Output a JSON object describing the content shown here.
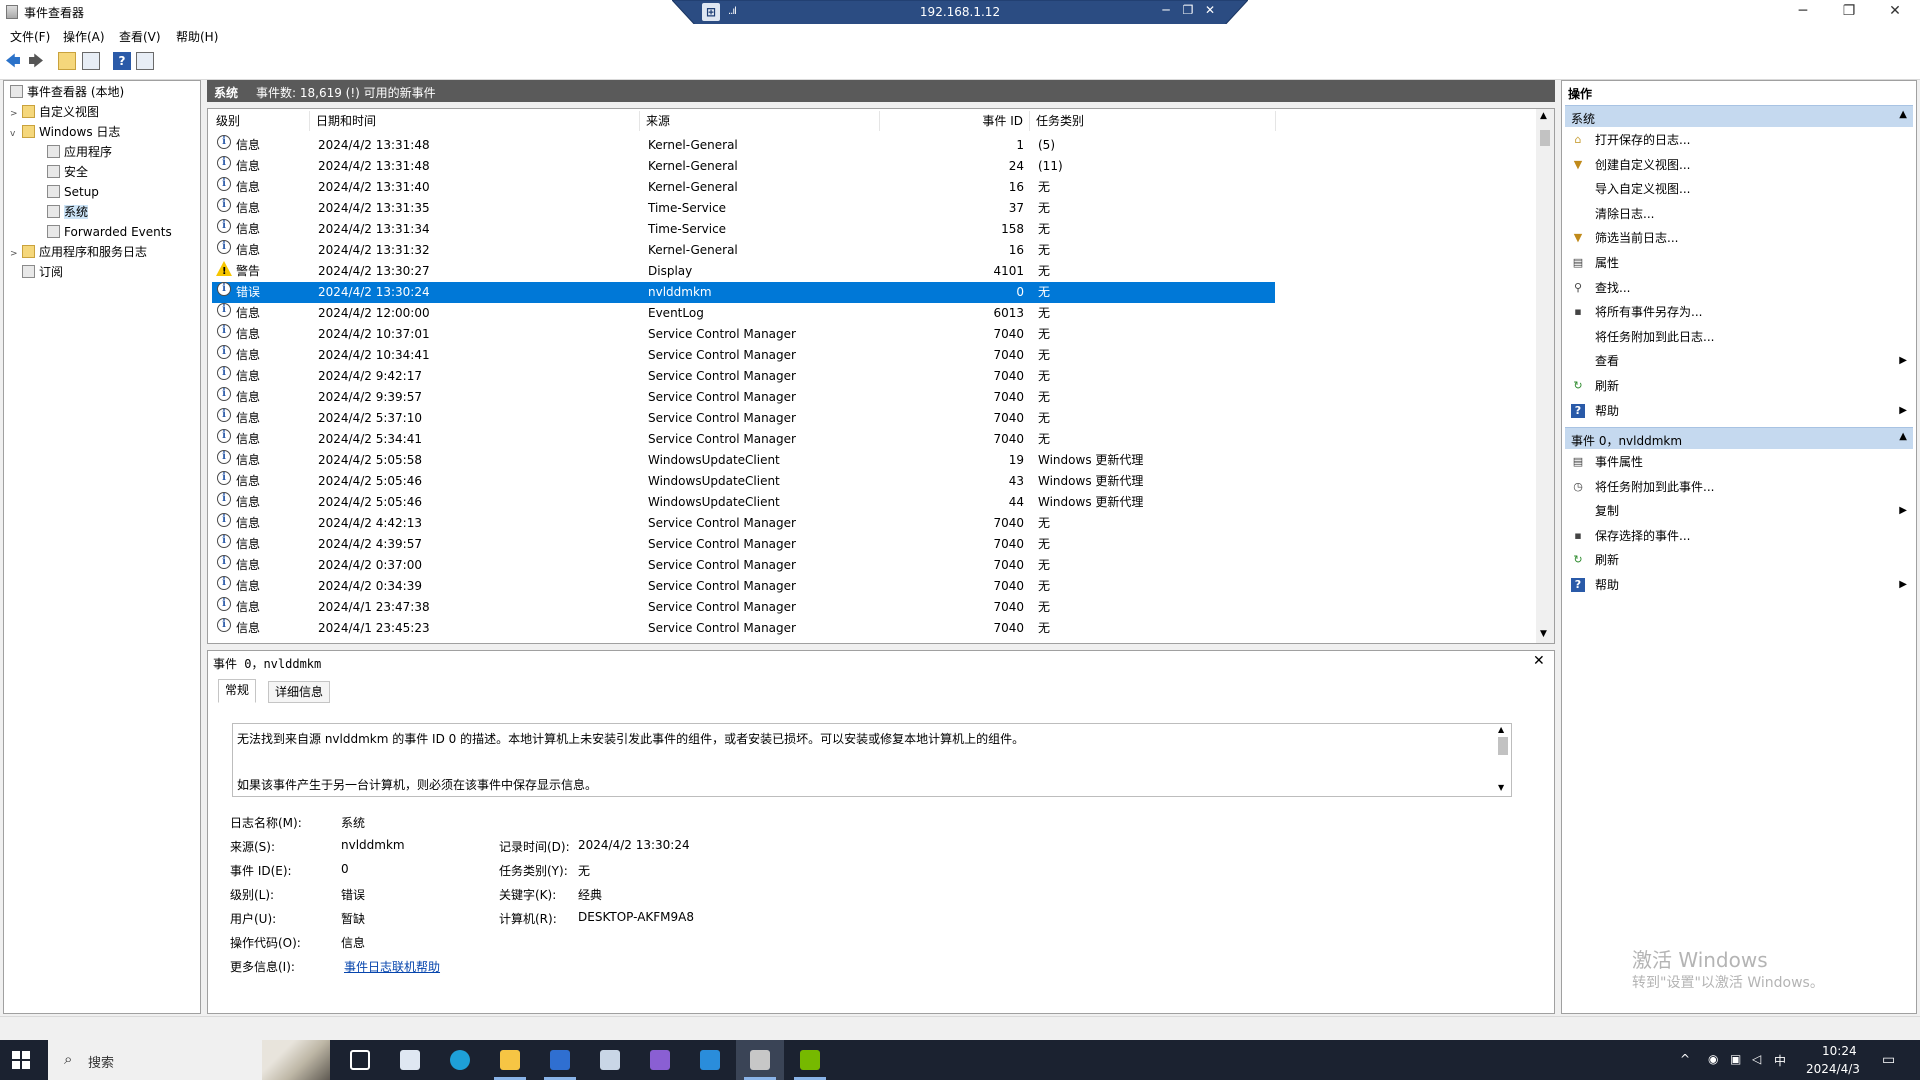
{
  "window": {
    "title": "事件查看器",
    "minimize": "─",
    "maximize": "❐",
    "close": "✕"
  },
  "rdp": {
    "ip": "192.168.1.12",
    "signal": "..ıl",
    "pin": "⊞",
    "min": "─",
    "restore": "❐",
    "close": "✕"
  },
  "menu": [
    "文件(F)",
    "操作(A)",
    "查看(V)",
    "帮助(H)"
  ],
  "toolbar": [
    "back-icon",
    "forward-icon",
    "up-folder-icon",
    "show-hide-tree-icon",
    "help-icon",
    "show-hide-action-icon"
  ],
  "tree": {
    "root": "事件查看器 (本地)",
    "custom_views": "自定义视图",
    "windows_logs": "Windows 日志",
    "application": "应用程序",
    "security": "安全",
    "setup": "Setup",
    "system": "系统",
    "forwarded": "Forwarded Events",
    "app_service_logs": "应用程序和服务日志",
    "subscriptions": "订阅"
  },
  "center_header": {
    "title": "系统",
    "summary": "事件数: 18,619 (!) 可用的新事件"
  },
  "columns": {
    "level": "级别",
    "datetime": "日期和时间",
    "source": "来源",
    "event_id": "事件 ID",
    "task": "任务类别"
  },
  "events": [
    {
      "type": "info",
      "level": "信息",
      "datetime": "2024/4/2 13:31:48",
      "source": "Kernel-General",
      "id": "1",
      "task": "(5)"
    },
    {
      "type": "info",
      "level": "信息",
      "datetime": "2024/4/2 13:31:48",
      "source": "Kernel-General",
      "id": "24",
      "task": "(11)"
    },
    {
      "type": "info",
      "level": "信息",
      "datetime": "2024/4/2 13:31:40",
      "source": "Kernel-General",
      "id": "16",
      "task": "无"
    },
    {
      "type": "info",
      "level": "信息",
      "datetime": "2024/4/2 13:31:35",
      "source": "Time-Service",
      "id": "37",
      "task": "无"
    },
    {
      "type": "info",
      "level": "信息",
      "datetime": "2024/4/2 13:31:34",
      "source": "Time-Service",
      "id": "158",
      "task": "无"
    },
    {
      "type": "info",
      "level": "信息",
      "datetime": "2024/4/2 13:31:32",
      "source": "Kernel-General",
      "id": "16",
      "task": "无"
    },
    {
      "type": "warn",
      "level": "警告",
      "datetime": "2024/4/2 13:30:27",
      "source": "Display",
      "id": "4101",
      "task": "无"
    },
    {
      "type": "info",
      "level": "错误",
      "datetime": "2024/4/2 13:30:24",
      "source": "nvlddmkm",
      "id": "0",
      "task": "无",
      "selected": true
    },
    {
      "type": "info",
      "level": "信息",
      "datetime": "2024/4/2 12:00:00",
      "source": "EventLog",
      "id": "6013",
      "task": "无"
    },
    {
      "type": "info",
      "level": "信息",
      "datetime": "2024/4/2 10:37:01",
      "source": "Service Control Manager",
      "id": "7040",
      "task": "无"
    },
    {
      "type": "info",
      "level": "信息",
      "datetime": "2024/4/2 10:34:41",
      "source": "Service Control Manager",
      "id": "7040",
      "task": "无"
    },
    {
      "type": "info",
      "level": "信息",
      "datetime": "2024/4/2 9:42:17",
      "source": "Service Control Manager",
      "id": "7040",
      "task": "无"
    },
    {
      "type": "info",
      "level": "信息",
      "datetime": "2024/4/2 9:39:57",
      "source": "Service Control Manager",
      "id": "7040",
      "task": "无"
    },
    {
      "type": "info",
      "level": "信息",
      "datetime": "2024/4/2 5:37:10",
      "source": "Service Control Manager",
      "id": "7040",
      "task": "无"
    },
    {
      "type": "info",
      "level": "信息",
      "datetime": "2024/4/2 5:34:41",
      "source": "Service Control Manager",
      "id": "7040",
      "task": "无"
    },
    {
      "type": "info",
      "level": "信息",
      "datetime": "2024/4/2 5:05:58",
      "source": "WindowsUpdateClient",
      "id": "19",
      "task": "Windows 更新代理"
    },
    {
      "type": "info",
      "level": "信息",
      "datetime": "2024/4/2 5:05:46",
      "source": "WindowsUpdateClient",
      "id": "43",
      "task": "Windows 更新代理"
    },
    {
      "type": "info",
      "level": "信息",
      "datetime": "2024/4/2 5:05:46",
      "source": "WindowsUpdateClient",
      "id": "44",
      "task": "Windows 更新代理"
    },
    {
      "type": "info",
      "level": "信息",
      "datetime": "2024/4/2 4:42:13",
      "source": "Service Control Manager",
      "id": "7040",
      "task": "无"
    },
    {
      "type": "info",
      "level": "信息",
      "datetime": "2024/4/2 4:39:57",
      "source": "Service Control Manager",
      "id": "7040",
      "task": "无"
    },
    {
      "type": "info",
      "level": "信息",
      "datetime": "2024/4/2 0:37:00",
      "source": "Service Control Manager",
      "id": "7040",
      "task": "无"
    },
    {
      "type": "info",
      "level": "信息",
      "datetime": "2024/4/2 0:34:39",
      "source": "Service Control Manager",
      "id": "7040",
      "task": "无"
    },
    {
      "type": "info",
      "level": "信息",
      "datetime": "2024/4/1 23:47:38",
      "source": "Service Control Manager",
      "id": "7040",
      "task": "无"
    },
    {
      "type": "info",
      "level": "信息",
      "datetime": "2024/4/1 23:45:23",
      "source": "Service Control Manager",
      "id": "7040",
      "task": "无"
    }
  ],
  "detail": {
    "title": "事件 0，nvlddmkm",
    "tab_general": "常规",
    "tab_details": "详细信息",
    "desc_line1": "无法找到来自源 nvlddmkm 的事件 ID 0 的描述。本地计算机上未安装引发此事件的组件，或者安装已损坏。可以安装或修复本地计算机上的组件。",
    "desc_line2": "如果该事件产生于另一台计算机，则必须在该事件中保存显示信息。",
    "log_name_label": "日志名称(M):",
    "log_name": "系统",
    "source_label": "来源(S):",
    "source": "nvlddmkm",
    "logged_label": "记录时间(D):",
    "logged": "2024/4/2 13:30:24",
    "event_id_label": "事件 ID(E):",
    "event_id": "0",
    "task_label": "任务类别(Y):",
    "task": "无",
    "level_label": "级别(L):",
    "level": "错误",
    "keywords_label": "关键字(K):",
    "keywords": "经典",
    "user_label": "用户(U):",
    "user": "暂缺",
    "computer_label": "计算机(R):",
    "computer": "DESKTOP-AKFM9A8",
    "opcode_label": "操作代码(O):",
    "opcode": "信息",
    "more_info_label": "更多信息(I):",
    "more_info_link": "事件日志联机帮助"
  },
  "actions": {
    "header": "操作",
    "section1": "系统",
    "items1": [
      {
        "icon": "open-log-icon",
        "label": "打开保存的日志..."
      },
      {
        "icon": "filter-create-icon",
        "label": "创建自定义视图..."
      },
      {
        "icon": "none",
        "label": "导入自定义视图..."
      },
      {
        "icon": "none",
        "label": "清除日志..."
      },
      {
        "icon": "filter-icon",
        "label": "筛选当前日志..."
      },
      {
        "icon": "properties-icon",
        "label": "属性"
      },
      {
        "icon": "find-icon",
        "label": "查找..."
      },
      {
        "icon": "save-icon",
        "label": "将所有事件另存为..."
      },
      {
        "icon": "none",
        "label": "将任务附加到此日志..."
      },
      {
        "icon": "none",
        "label": "查看",
        "submenu": true
      },
      {
        "icon": "refresh-icon",
        "label": "刷新"
      },
      {
        "icon": "help-icon",
        "label": "帮助",
        "submenu": true
      }
    ],
    "section2": "事件 0，nvlddmkm",
    "items2": [
      {
        "icon": "event-properties-icon",
        "label": "事件属性"
      },
      {
        "icon": "attach-task-icon",
        "label": "将任务附加到此事件..."
      },
      {
        "icon": "none",
        "label": "复制",
        "submenu": true
      },
      {
        "icon": "save-icon",
        "label": "保存选择的事件..."
      },
      {
        "icon": "refresh-icon",
        "label": "刷新"
      },
      {
        "icon": "help-icon",
        "label": "帮助",
        "submenu": true
      }
    ]
  },
  "watermark": {
    "line1": "激活 Windows",
    "line2": "转到\"设置\"以激活 Windows。"
  },
  "taskbar": {
    "search_placeholder": "搜索",
    "apps": [
      "task-view-icon",
      "remote-desktop-icon",
      "edge-icon",
      "file-explorer-icon",
      "app-icon",
      "app-icon-2",
      "visual-studio-icon",
      "vscode-icon",
      "event-viewer-icon",
      "nvidia-icon"
    ],
    "tray": {
      "ime": "中",
      "time": "10:24",
      "date": "2024/4/3"
    }
  },
  "colors": {
    "selection": "#0078d7",
    "section": "#c5d9ef",
    "taskbar": "#1b2230",
    "header": "#5a5a5a"
  }
}
